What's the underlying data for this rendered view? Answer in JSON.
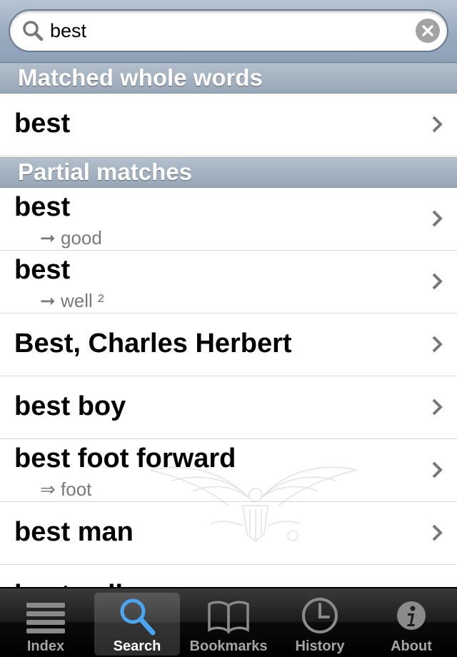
{
  "search": {
    "value": "best",
    "placeholder": ""
  },
  "sections": {
    "whole": "Matched whole words",
    "partial": "Partial matches"
  },
  "rows": [
    {
      "title": "best",
      "sub": ""
    },
    {
      "title": "best",
      "sub": "➞ good"
    },
    {
      "title": "best",
      "sub": "➞ well ²"
    },
    {
      "title": "Best, Charles Herbert",
      "sub": ""
    },
    {
      "title": "best boy",
      "sub": ""
    },
    {
      "title": "best foot forward",
      "sub": "⇒ foot"
    },
    {
      "title": "best man",
      "sub": ""
    },
    {
      "title": "best seller",
      "sub": ""
    }
  ],
  "tabs": [
    {
      "label": "Index",
      "icon": "index-icon"
    },
    {
      "label": "Search",
      "icon": "search-icon"
    },
    {
      "label": "Bookmarks",
      "icon": "book-icon"
    },
    {
      "label": "History",
      "icon": "clock-icon"
    },
    {
      "label": "About",
      "icon": "info-icon"
    }
  ],
  "active_tab": "Search",
  "colors": {
    "search_bar": "#97a9bd",
    "section_header": "#a5b3c2",
    "tab_bar": "#1c1c1c",
    "active_tab_icon": "#4aa6f0"
  }
}
